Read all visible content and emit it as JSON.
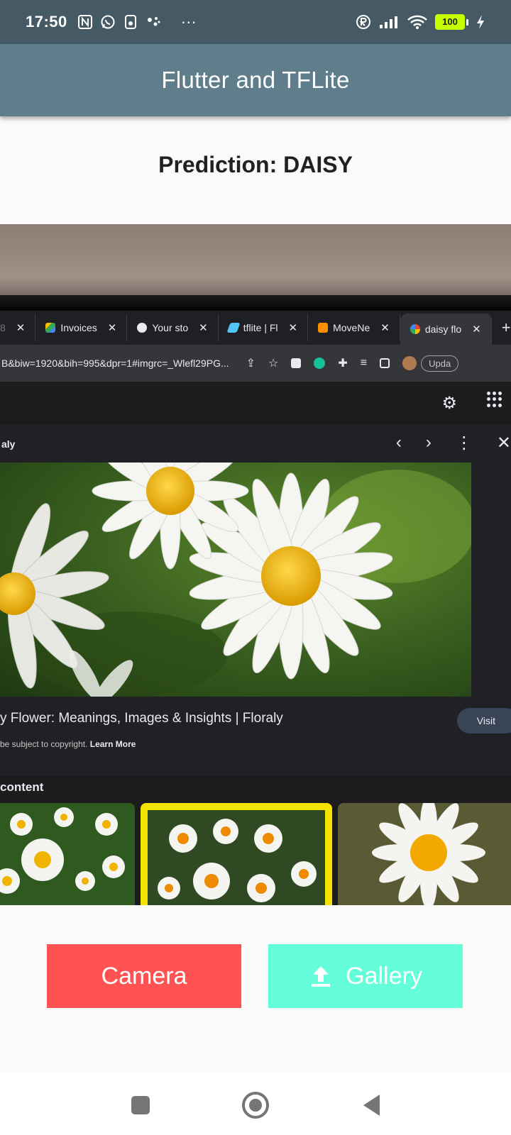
{
  "status_bar": {
    "time": "17:50",
    "more": "···",
    "battery": "100",
    "left_icons": [
      "nfc-icon",
      "whatsapp-icon",
      "notification-icon",
      "assistant-icon"
    ],
    "right_icons": [
      "registered-icon",
      "signal-icon",
      "wifi-icon",
      "battery-icon",
      "charging-icon"
    ]
  },
  "app_bar": {
    "title": "Flutter and TFLite"
  },
  "prediction": {
    "text": "Prediction: DAISY"
  },
  "photo": {
    "browser_tabs": [
      {
        "label": "8",
        "close": "✕"
      },
      {
        "label": "Invoices",
        "close": "✕"
      },
      {
        "label": "Your sto",
        "close": "✕"
      },
      {
        "label": "tflite | Fl",
        "close": "✕"
      },
      {
        "label": "MoveNe",
        "close": "✕"
      },
      {
        "label": "daisy flo",
        "close": "✕"
      }
    ],
    "new_tab": "+",
    "url": "B&biw=1920&bih=995&dpr=1#imgrc=_Wlefl29PG...",
    "update_button": "Upda",
    "site_name": "aly",
    "caption_title": "y Flower: Meanings, Images & Insights | Floraly",
    "caption_sub": "be subject to copyright.",
    "learn_more": "Learn More",
    "visit_button": "Visit",
    "related_label": "content"
  },
  "buttons": {
    "camera": "Camera",
    "gallery": "Gallery"
  },
  "colors": {
    "status_bar": "#455a64",
    "app_bar": "#607d8b",
    "camera_button": "#ff5252",
    "gallery_button": "#64ffda"
  }
}
